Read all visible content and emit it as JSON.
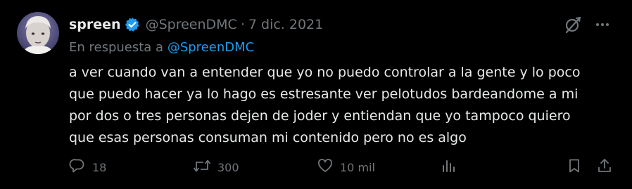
{
  "tweet": {
    "display_name": "spreen",
    "handle": "@SpreenDMC",
    "separator": "·",
    "date": "7 dic. 2021",
    "reply_prefix": "En respuesta a ",
    "reply_mention": "@SpreenDMC",
    "text_lines": [
      "a ver cuando van a entender que yo no puedo controlar a la gente y lo poco",
      "que puedo hacer ya lo hago es estresante ver pelotudos bardeandome a mi",
      "por dos o tres personas dejen de joder y entiendan que yo tampoco quiero",
      "que esas personas consuman mi contenido pero no es algo"
    ]
  },
  "actions": {
    "replies": "18",
    "retweets": "300",
    "likes": "10 mil"
  },
  "icons": {
    "avatar": "user-avatar",
    "verified": "verified-badge-icon",
    "grok": "grok-icon",
    "more": "more-icon",
    "reply": "reply-icon",
    "retweet": "retweet-icon",
    "like": "heart-icon",
    "views": "views-icon",
    "bookmark": "bookmark-icon",
    "share": "share-icon"
  },
  "colors": {
    "background": "#000000",
    "text": "#e7e9ea",
    "secondary": "#71767b",
    "link": "#1d9bf0",
    "verified": "#1d9bf0"
  }
}
